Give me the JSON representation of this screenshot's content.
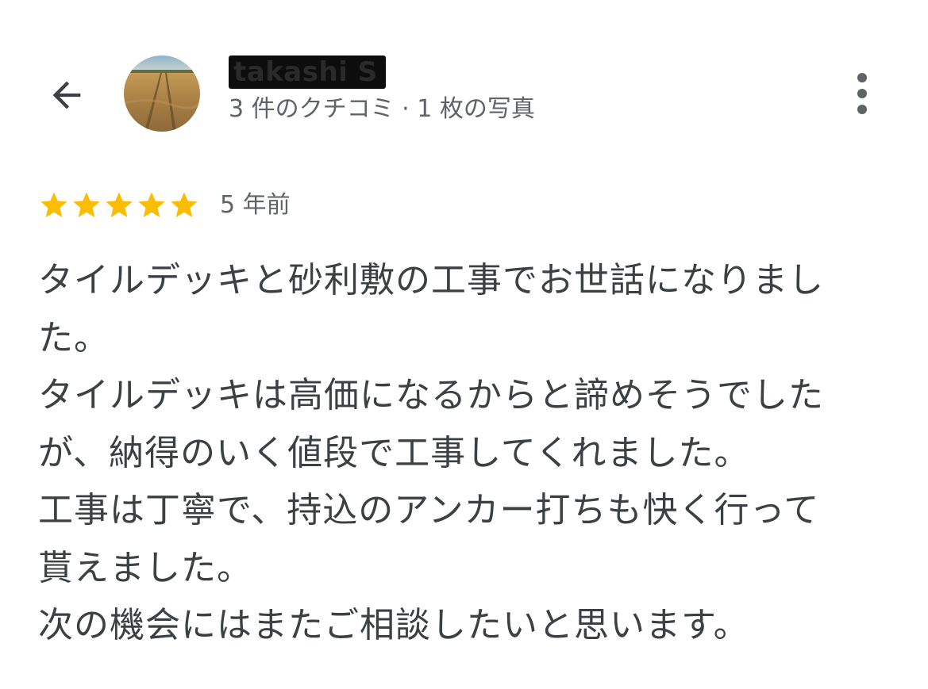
{
  "header": {
    "back_icon": "arrow-left-icon",
    "user_name": "takashi S",
    "user_stats": "3 件のクチコミ · 1 枚の写真",
    "more_icon": "more-vert-icon"
  },
  "review": {
    "rating": 5,
    "rating_max": 5,
    "star_color": "#fbbc04",
    "date": "5 年前",
    "lines": [
      "タイルデッキと砂利敷の工事でお世話になりまし",
      "た。",
      "タイルデッキは高価になるからと諦めそうでした",
      "が、納得のいく値段で工事してくれました。",
      "工事は丁寧で、持込のアンカー打ちも快く行って",
      "貰えました。",
      "次の機会にはまたご相談したいと思います。"
    ]
  }
}
